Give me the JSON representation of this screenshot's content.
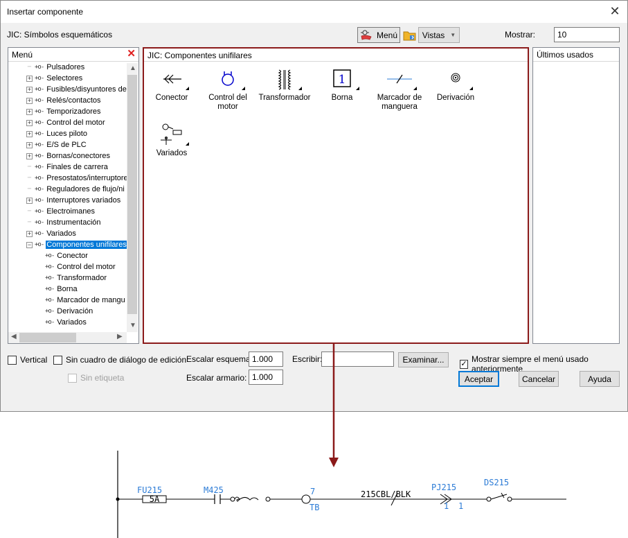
{
  "window": {
    "title": "Insertar componente"
  },
  "header": {
    "library_label": "JIC: Símbolos esquemáticos",
    "menu_button": "Menú",
    "views_button": "Vistas",
    "show_label": "Mostrar:",
    "show_value": "10"
  },
  "menu_panel": {
    "title": "Menú",
    "items": [
      {
        "label": "Pulsadores",
        "expandable": false
      },
      {
        "label": "Selectores",
        "expandable": true
      },
      {
        "label": "Fusibles/disyuntores de",
        "expandable": true
      },
      {
        "label": "Relés/contactos",
        "expandable": true
      },
      {
        "label": "Temporizadores",
        "expandable": true
      },
      {
        "label": "Control del motor",
        "expandable": true
      },
      {
        "label": "Luces piloto",
        "expandable": true
      },
      {
        "label": "E/S de PLC",
        "expandable": true
      },
      {
        "label": "Bornas/conectores",
        "expandable": true
      },
      {
        "label": "Finales de carrera",
        "expandable": false
      },
      {
        "label": "Presostatos/interruptore",
        "expandable": false
      },
      {
        "label": "Reguladores de flujo/ni",
        "expandable": false
      },
      {
        "label": "Interruptores variados",
        "expandable": true
      },
      {
        "label": "Electroimanes",
        "expandable": false
      },
      {
        "label": "Instrumentación",
        "expandable": false
      },
      {
        "label": "Variados",
        "expandable": true
      },
      {
        "label": "Componentes unifilares",
        "expandable": true,
        "expanded": true,
        "selected": true
      },
      {
        "label": "Conector",
        "child": true
      },
      {
        "label": "Control del motor",
        "child": true
      },
      {
        "label": "Transformador",
        "child": true
      },
      {
        "label": "Borna",
        "child": true
      },
      {
        "label": "Marcador de mangu",
        "child": true
      },
      {
        "label": "Derivación",
        "child": true
      },
      {
        "label": "Variados",
        "child": true
      }
    ]
  },
  "components_panel": {
    "title": "JIC: Componentes unifilares",
    "items": [
      {
        "label": "Conector",
        "icon": "connector-icon"
      },
      {
        "label": "Control del motor",
        "icon": "motor-control-icon"
      },
      {
        "label": "Transformador",
        "icon": "transformer-icon"
      },
      {
        "label": "Borna",
        "icon": "terminal-icon"
      },
      {
        "label": "Marcador de manguera",
        "icon": "cable-marker-icon"
      },
      {
        "label": "Derivación",
        "icon": "splice-icon"
      },
      {
        "label": "Variados",
        "icon": "misc-icon"
      }
    ]
  },
  "recent_panel": {
    "title": "Últimos usados"
  },
  "options": {
    "vertical": "Vertical",
    "no_dialog": "Sin cuadro de diálogo de edición",
    "no_tag": "Sin etiqueta",
    "scale_schematic_label": "Escalar esquema:",
    "scale_schematic_value": "1.000",
    "scale_panel_label": "Escalar armario:",
    "scale_panel_value": "1.000",
    "type_label": "Escribir:",
    "type_value": "",
    "browse_button": "Examinar...",
    "always_show_menu": "Mostrar siempre el menú usado anteriormente",
    "always_show_menu_checked": true
  },
  "footer": {
    "ok_button": "Aceptar",
    "cancel_button": "Cancelar",
    "help_button": "Ayuda"
  },
  "schematic": {
    "fuse_tag": "FU215",
    "fuse_rating": "5A",
    "motor_tag": "M425",
    "terminal_number": "7",
    "terminal_tag": "TB",
    "cable_label": "215CBL/BLK",
    "connector_tag": "PJ215",
    "connector_pin_left": "1",
    "connector_pin_right": "1",
    "switch_tag": "DS215"
  },
  "colors": {
    "accent": "#0078d7",
    "highlight_frame": "#8b1a1a",
    "schematic_blue": "#2b7bd6"
  }
}
